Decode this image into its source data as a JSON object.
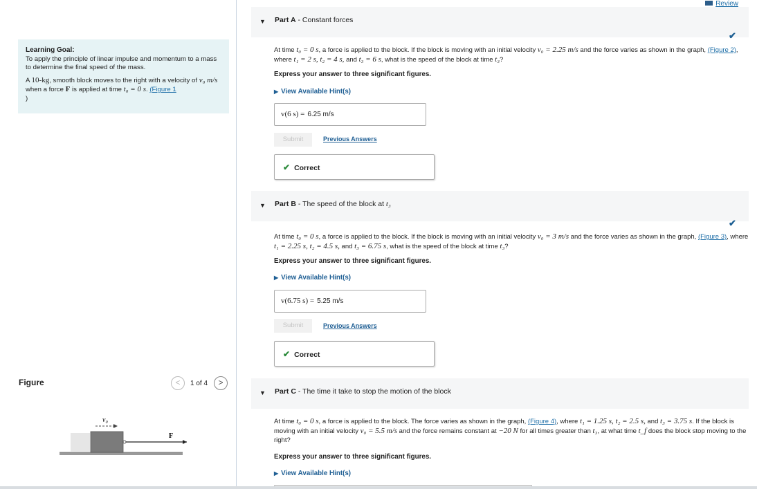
{
  "review": {
    "label": "Review"
  },
  "goal": {
    "heading": "Learning Goal:",
    "text": "To apply the principle of linear impulse and momentum to a mass to determine the final speed of the mass.",
    "problem_pre": "A ",
    "mass": "10-kg",
    "problem_mid": ", smooth block moves to the right with a velocity of ",
    "v0": "v₀ m/s",
    "problem_mid2": " when a force ",
    "force": "F",
    "problem_mid3": " is applied at time ",
    "t0": "t₀ = 0 s",
    "problem_end": ". ",
    "figure_link": "(Figure 1",
    "figure_link_close": ")"
  },
  "figure": {
    "title": "Figure",
    "counter": "1 of 4",
    "prev": "<",
    "next": ">",
    "v_label": "v₀",
    "f_label": "F"
  },
  "parts": [
    {
      "letter": "Part A",
      "title": " - Constant forces",
      "question_pre": "At time ",
      "question_math1": "t₀ = 0 s",
      "question_mid1": ", a force is applied to the block. If the block is moving with an initial velocity ",
      "question_math2": "v₀ = 2.25 m/s",
      "question_mid2": " and the force varies as shown in the graph, ",
      "fig_link": "(Figure 2)",
      "question_mid3": ", where ",
      "question_math3": "t₁ = 2 s, t₂ = 4 s,",
      "question_mid4": " and ",
      "question_math4": "t₃ = 6 s",
      "question_end": ", what is the speed of the block at time ",
      "question_math5": "t₃",
      "question_q": "?",
      "instruction": "Express your answer to three significant figures.",
      "hint": "View Available Hint(s)",
      "answer_lhs": "v(6 s) =",
      "answer_val": "6.25  m/s",
      "submit": "Submit",
      "previous": "Previous Answers",
      "correct": "Correct"
    },
    {
      "letter": "Part B",
      "title": " - The speed of the block at ",
      "title_math": "t₃",
      "question_pre": "At time ",
      "question_math1": "t₀ = 0 s",
      "question_mid1": ", a force is applied to the block. If the block is moving with an initial velocity ",
      "question_math2": "v₀ = 3 m/s",
      "question_mid2": " and the force varies as shown in the graph, ",
      "fig_link": "(Figure 3)",
      "question_mid3": ", where ",
      "question_math3": "t₁ = 2.25 s, t₂ = 4.5 s,",
      "question_mid4": " and ",
      "question_math4": "t₃ = 6.75 s",
      "question_end": ", what is the speed of the block at time ",
      "question_math5": "t₃",
      "question_q": "?",
      "instruction": "Express your answer to three significant figures.",
      "hint": "View Available Hint(s)",
      "answer_lhs": "v(6.75 s) =",
      "answer_val": "5.25  m/s",
      "submit": "Submit",
      "previous": "Previous Answers",
      "correct": "Correct"
    },
    {
      "letter": "Part C",
      "title": " - The time it take to stop the motion of the block",
      "question_pre": "At time ",
      "question_math1": "t₀ = 0 s",
      "question_mid1": ", a force is applied to the block. The force varies as shown in the graph, ",
      "fig_link": "(Figure 4)",
      "question_mid2": ", where ",
      "question_math2": "t₁ = 1.25 s, t₂ = 2.5 s,",
      "question_mid3": " and ",
      "question_math3": "t₃ = 3.75 s",
      "question_mid4": ". If the block is moving with an initial velocity ",
      "question_math4": "v₀ = 5.5 m/s",
      "question_mid5": " and the force remains constant at ",
      "question_math5": "−20 N",
      "question_mid6": " for all times greater than ",
      "question_math6": "t₃",
      "question_mid7": ", at what time ",
      "question_math7": "t_f",
      "question_end": " does the block stop moving to the right?",
      "instruction": "Express your answer to three significant figures.",
      "hint": "View Available Hint(s)"
    }
  ],
  "icons": {
    "check_color": "#1d5f93",
    "correct_color": "#2a8a3a",
    "link_color": "#1f6fa8"
  }
}
